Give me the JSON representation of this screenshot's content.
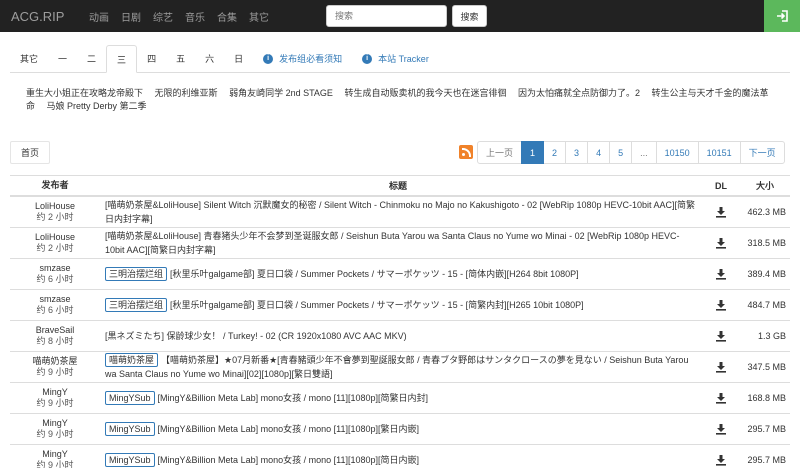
{
  "nav": {
    "brand": "ACG.RIP",
    "items": [
      "动画",
      "日剧",
      "综艺",
      "音乐",
      "合集",
      "其它"
    ],
    "search_placeholder": "搜索",
    "search_button": "搜索",
    "login_icon": "sign-in-icon",
    "login_color": "#5cb85c"
  },
  "tabs": {
    "days": [
      "其它",
      "一",
      "二",
      "三",
      "四",
      "五",
      "六",
      "日"
    ],
    "active": "三",
    "links": [
      "发布组必看须知",
      "本站 Tracker"
    ],
    "link_icon": "info-circle-icon"
  },
  "schedule": [
    "重生大小姐正在攻略龙帝殿下",
    "无限的利维亚斯",
    "弱角友崎同学 2nd STAGE",
    "转生成自动贩卖机的我今天也在迷宫徘徊",
    "因为太怕痛就全点防御力了。2",
    "转生公主与天才千金的魔法革命",
    "马娘 Pretty Derby 第二季"
  ],
  "pagination": {
    "home": "首页",
    "prev": "上一页",
    "pages": [
      "1",
      "2",
      "3",
      "4",
      "5",
      "...",
      "10150",
      "10151"
    ],
    "next": "下一页",
    "active": "1",
    "rss_icon": "rss-icon"
  },
  "table": {
    "headers": {
      "publisher": "发布者",
      "title": "标题",
      "dl": "DL",
      "size": "大小"
    },
    "rows": [
      {
        "publisher": "LoliHouse",
        "time": "约 2 小时",
        "label": "",
        "title": "[喵萌奶茶屋&LoliHouse] Silent Witch 沉默魔女的秘密 / Silent Witch - Chinmoku no Majo no Kakushigoto - 02 [WebRip 1080p HEVC-10bit AAC][简繁日内封字幕]",
        "size": "462.3 MB"
      },
      {
        "publisher": "LoliHouse",
        "time": "约 2 小时",
        "label": "",
        "title": "[喵萌奶茶屋&LoliHouse] 青春猪头少年不会梦到圣诞服女郎 / Seishun Buta Yarou wa Santa Claus no Yume wo Minai - 02 [WebRip 1080p HEVC-10bit AAC][简繁日内封字幕]",
        "size": "318.5 MB"
      },
      {
        "publisher": "smzase",
        "time": "约 6 小时",
        "label": "三明治摆烂组",
        "title": "[秋里乐叶galgame部] 夏日口袋 / Summer Pockets / サマーポケッツ - 15 - [简体内嵌][H264 8bit 1080P]",
        "size": "389.4 MB"
      },
      {
        "publisher": "smzase",
        "time": "约 6 小时",
        "label": "三明治摆烂组",
        "title": "[秋里乐叶galgame部] 夏日口袋 / Summer Pockets / サマーポケッツ - 15 - [简繁内封][H265 10bit 1080P]",
        "size": "484.7 MB"
      },
      {
        "publisher": "BraveSail",
        "time": "约 8 小时",
        "label": "",
        "title": "[黒ネズミたち] 保龄球少女！ / Turkey! - 02 (CR 1920x1080 AVC AAC MKV)",
        "size": "1.3 GB"
      },
      {
        "publisher": "喵萌奶茶屋",
        "time": "约 9 小时",
        "label": "喵萌奶茶屋",
        "title": "【喵萌奶茶屋】★07月新番★[青春豬頭少年不會夢到聖誕服女郎 / 青春ブタ野郎はサンタクロースの夢を見ない / Seishun Buta Yarou wa Santa Claus no Yume wo Minai][02][1080p][繁日雙語]",
        "size": "347.5 MB"
      },
      {
        "publisher": "MingY",
        "time": "约 9 小时",
        "label": "MingYSub",
        "title": "[MingY&Billion Meta Lab] mono女孩 / mono [11][1080p][简繁日内封]",
        "size": "168.8 MB"
      },
      {
        "publisher": "MingY",
        "time": "约 9 小时",
        "label": "MingYSub",
        "title": "[MingY&Billion Meta Lab] mono女孩 / mono [11][1080p][繁日内嵌]",
        "size": "295.7 MB"
      },
      {
        "publisher": "MingY",
        "time": "约 9 小时",
        "label": "MingYSub",
        "title": "[MingY&Billion Meta Lab] mono女孩 / mono [11][1080p][简日内嵌]",
        "size": "295.7 MB"
      }
    ],
    "dl_icon": "download-icon"
  }
}
